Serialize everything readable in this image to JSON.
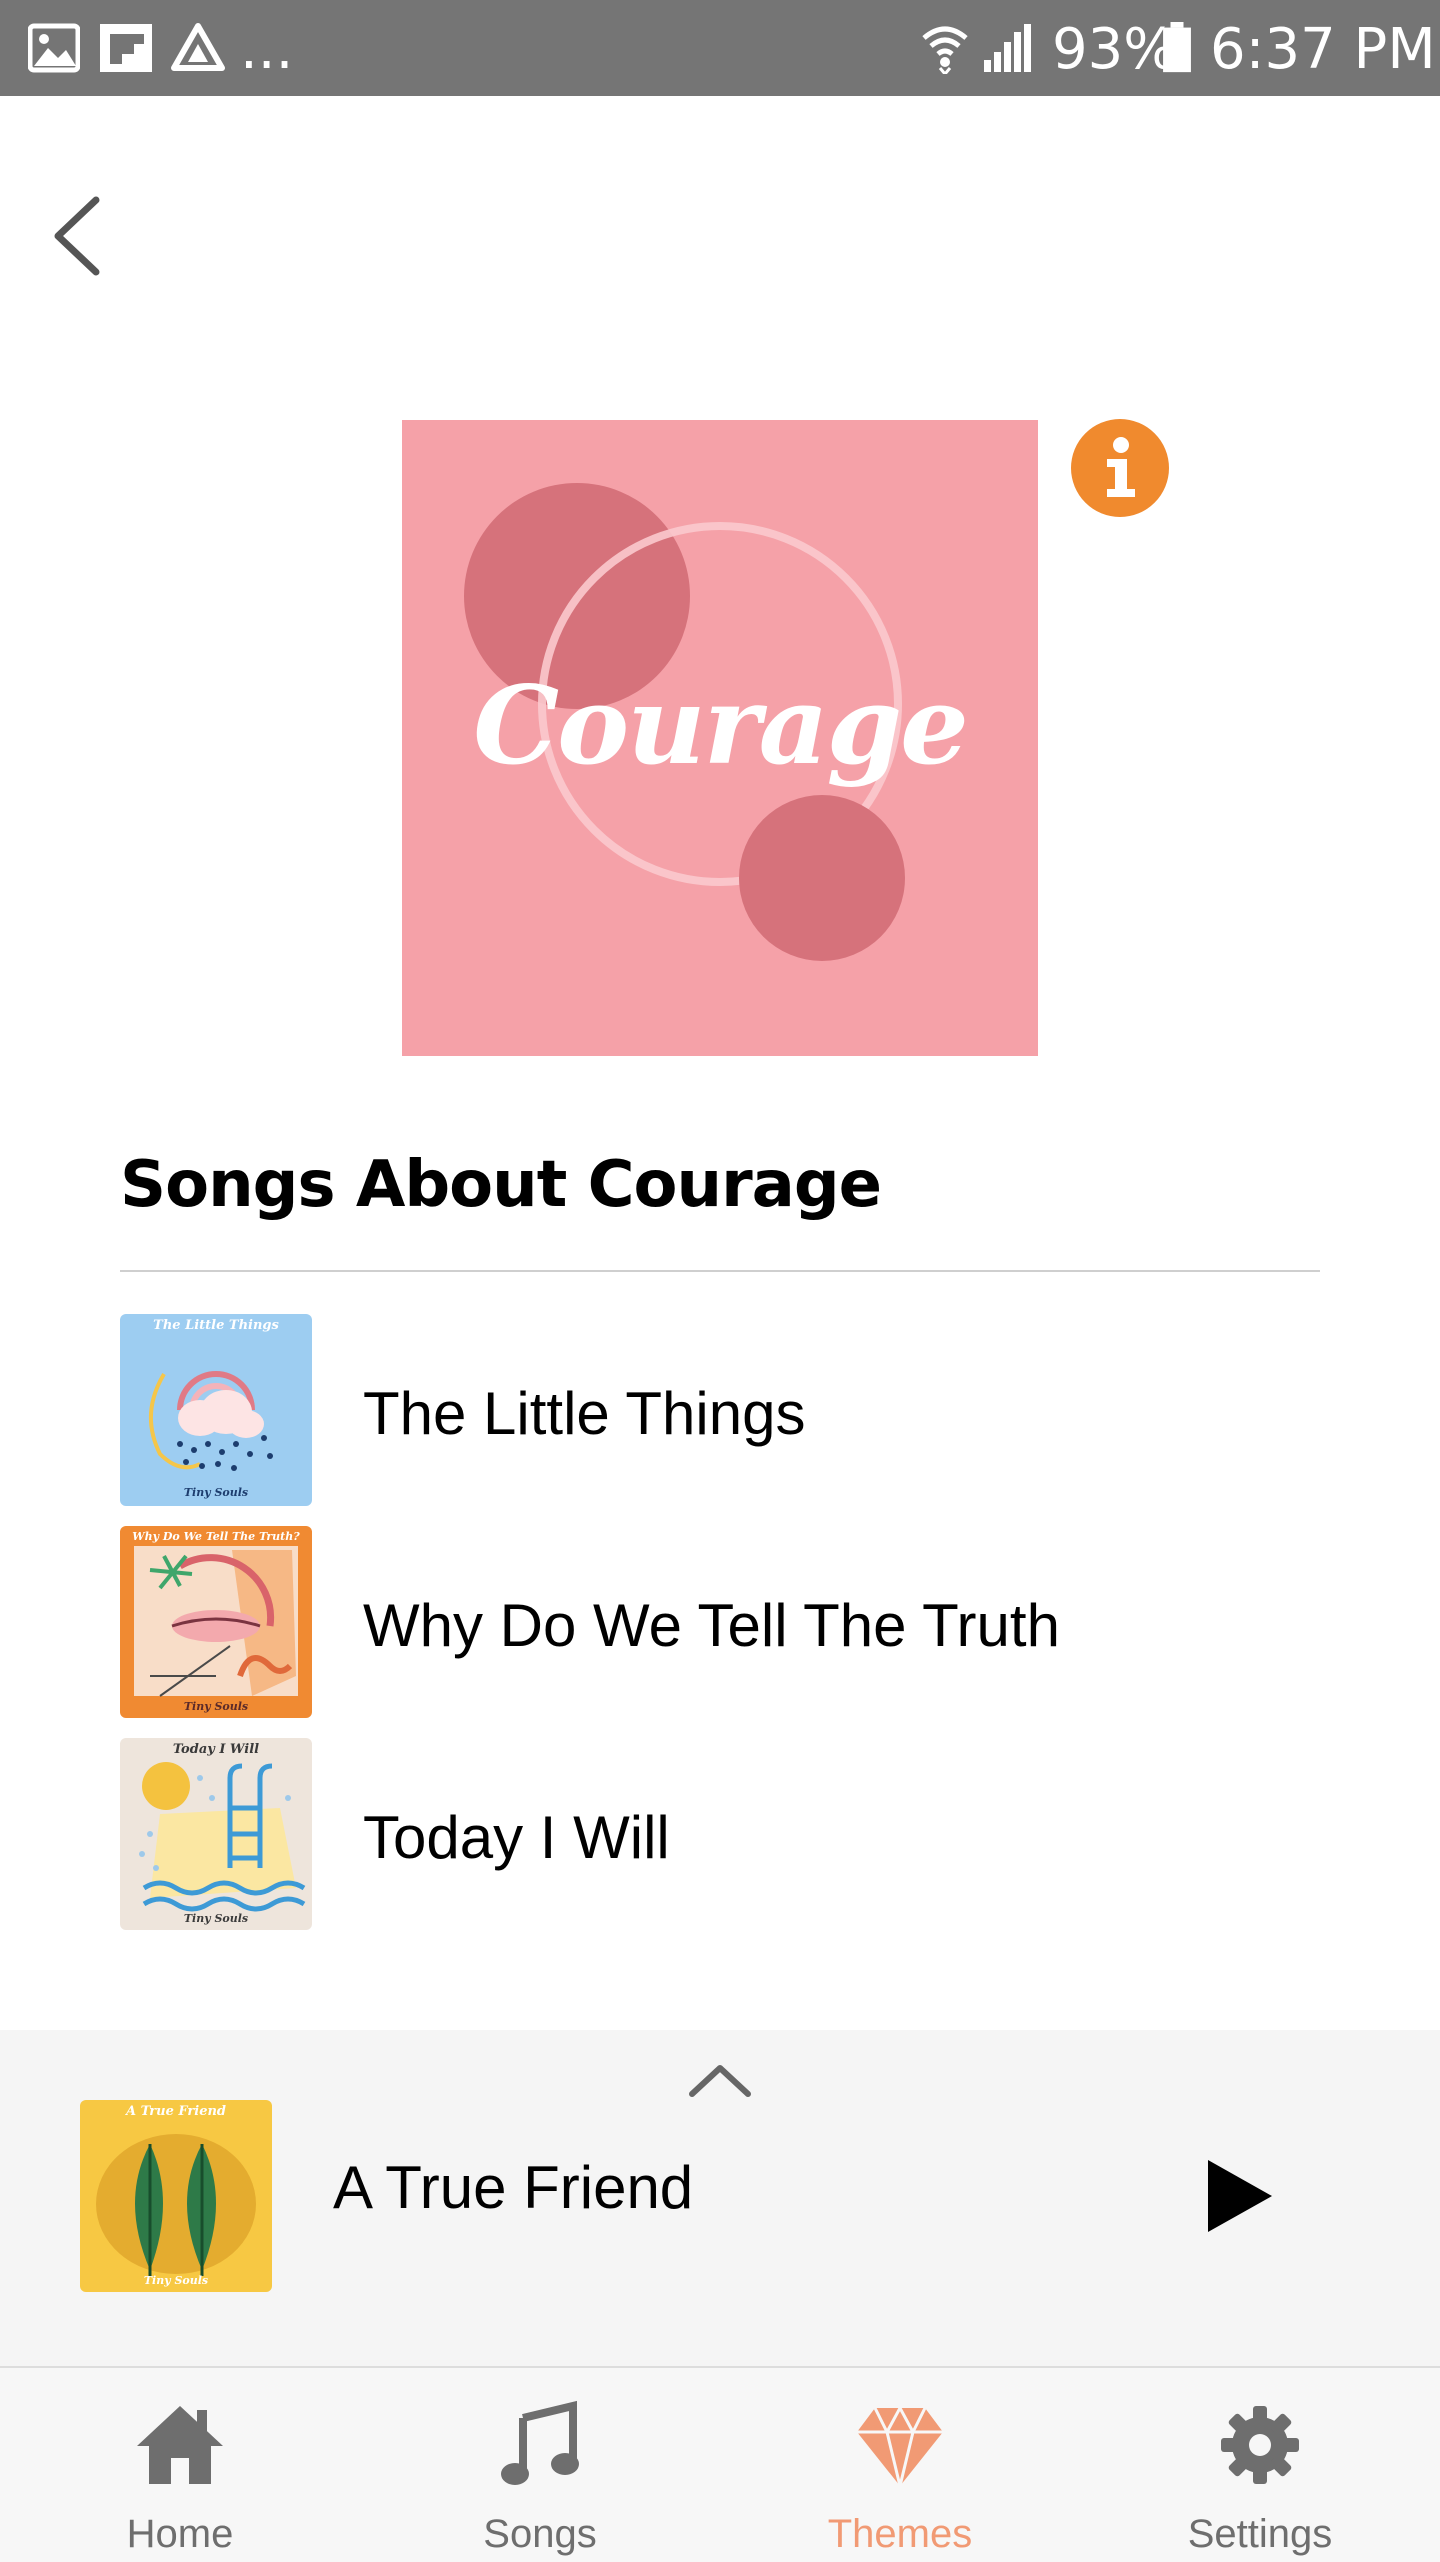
{
  "status_bar": {
    "icons": [
      "image-icon",
      "flipboard-icon",
      "drive-icon",
      "more-icon",
      "wifi-icon",
      "signal-icon",
      "battery-icon"
    ],
    "battery": "93%",
    "time": "6:37 PM",
    "more": "..."
  },
  "header": {
    "back_icon": "chevron-left-icon"
  },
  "theme": {
    "cover_text": "Courage",
    "cover_color": "#f5a1a8",
    "info_icon": "info-icon",
    "info_color": "#f08a2e"
  },
  "section": {
    "title": "Songs About Courage"
  },
  "songs": [
    {
      "title": "The Little Things",
      "art_title": "The Little Things",
      "art_footer": "Tiny Souls"
    },
    {
      "title": "Why Do We Tell The Truth",
      "art_title": "Why Do We Tell The Truth?",
      "art_footer": "Tiny Souls"
    },
    {
      "title": "Today I Will",
      "art_title": "Today I Will",
      "art_footer": "Tiny Souls"
    }
  ],
  "player": {
    "title": "A True Friend",
    "art_title": "A True Friend",
    "art_footer": "Tiny Souls",
    "expand_icon": "chevron-up-icon",
    "play_icon": "play-icon"
  },
  "nav": {
    "items": [
      {
        "label": "Home",
        "icon": "home-icon",
        "active": false
      },
      {
        "label": "Songs",
        "icon": "music-note-icon",
        "active": false
      },
      {
        "label": "Themes",
        "icon": "diamond-icon",
        "active": true
      },
      {
        "label": "Settings",
        "icon": "gear-icon",
        "active": false
      }
    ],
    "active_color": "#f19a74",
    "inactive_color": "#6e6e6e"
  }
}
